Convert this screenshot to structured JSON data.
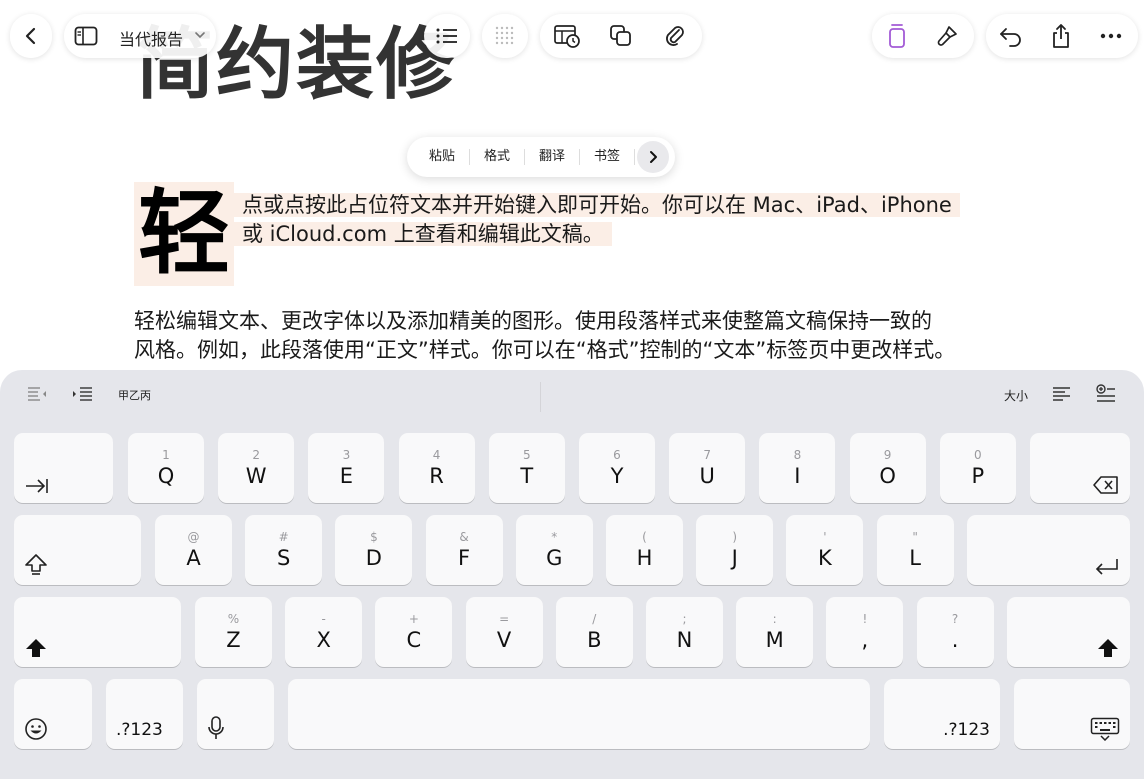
{
  "toolbar": {
    "doc_name": "当代报告",
    "icons": [
      "chevron-left-icon",
      "sidebar-icon",
      "chevron-down-icon",
      "list-icon",
      "grid-icon",
      "table-clock-icon",
      "copy-shapes-icon",
      "paperclip-icon",
      "fill-icon",
      "paintbrush-icon",
      "undo-icon",
      "share-icon",
      "more-icon"
    ],
    "accent": "#a35bd6"
  },
  "document": {
    "title_large": "简约装修",
    "dropcap": "轻",
    "placeholder_line1": "点或点按此占位符文本并开始键入即可开始。你可以在 Mac、iPad、iPhone",
    "placeholder_line2": "或 iCloud.com 上查看和编辑此文稿。",
    "body_line1": "轻松编辑文本、更改字体以及添加精美的图形。使用段落样式来使整篇文稿保持一致的",
    "body_line2": "风格。例如，此段落使用“正文”样式。你可以在“格式”控制的“文本”标签页中更改样式。"
  },
  "context_menu": {
    "items": [
      "粘贴",
      "格式",
      "翻译",
      "书签"
    ]
  },
  "keyboard_bar": {
    "style_label": "甲乙丙",
    "size_label": "大小"
  },
  "keyboard": {
    "row1": [
      {
        "main": "Q",
        "sub": "1"
      },
      {
        "main": "W",
        "sub": "2"
      },
      {
        "main": "E",
        "sub": "3"
      },
      {
        "main": "R",
        "sub": "4"
      },
      {
        "main": "T",
        "sub": "5"
      },
      {
        "main": "Y",
        "sub": "6"
      },
      {
        "main": "U",
        "sub": "7"
      },
      {
        "main": "I",
        "sub": "8"
      },
      {
        "main": "O",
        "sub": "9"
      },
      {
        "main": "P",
        "sub": "0"
      }
    ],
    "row2": [
      {
        "main": "A",
        "sub": "@"
      },
      {
        "main": "S",
        "sub": "#"
      },
      {
        "main": "D",
        "sub": "$"
      },
      {
        "main": "F",
        "sub": "&"
      },
      {
        "main": "G",
        "sub": "*"
      },
      {
        "main": "H",
        "sub": "("
      },
      {
        "main": "J",
        "sub": ")"
      },
      {
        "main": "K",
        "sub": "'"
      },
      {
        "main": "L",
        "sub": "\""
      }
    ],
    "row3": [
      {
        "main": "Z",
        "sub": "%"
      },
      {
        "main": "X",
        "sub": "-"
      },
      {
        "main": "C",
        "sub": "+"
      },
      {
        "main": "V",
        "sub": "="
      },
      {
        "main": "B",
        "sub": "/"
      },
      {
        "main": "N",
        "sub": ";"
      },
      {
        "main": "M",
        "sub": ":"
      },
      {
        "main": ",",
        "sub": "!"
      },
      {
        "main": ".",
        "sub": "?"
      }
    ],
    "numbers_label": ".?123"
  }
}
